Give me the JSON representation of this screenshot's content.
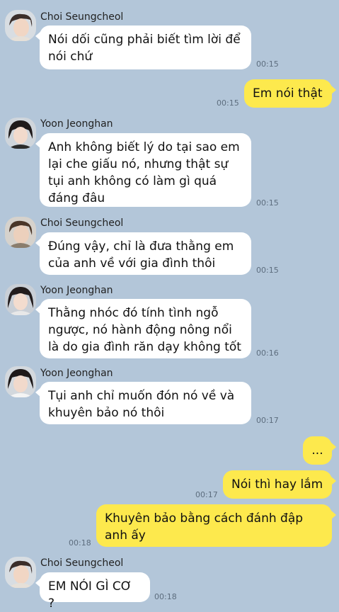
{
  "messages": [
    {
      "sender": "Choi Seungcheol",
      "text": "Nói dối cũng phải biết tìm lời để nói chứ",
      "time": "00:15"
    },
    {
      "text": "Em nói thật",
      "time": "00:15"
    },
    {
      "sender": "Yoon Jeonghan",
      "text": "Anh không biết lý do tại sao em lại che giấu nó, nhưng thật sự tụi anh không có làm gì quá đáng đâu",
      "time": "00:15"
    },
    {
      "sender": "Choi Seungcheol",
      "text": "Đúng vậy, chỉ là đưa thằng em của anh về với gia đình thôi",
      "time": "00:15"
    },
    {
      "sender": "Yoon Jeonghan",
      "text": "Thằng nhóc đó tính tình ngỗ ngược, nó hành động nông nổi là do gia đình răn dạy không tốt",
      "time": "00:16"
    },
    {
      "sender": "Yoon Jeonghan",
      "text": "Tụi anh chỉ muốn đón nó về và khuyên bảo nó thôi",
      "time": "00:17"
    },
    {
      "text": "...",
      "time": ""
    },
    {
      "text": "Nói thì hay lắm",
      "time": "00:17"
    },
    {
      "text": "Khuyên bảo bằng cách đánh đập anh ấy",
      "time": "00:18"
    },
    {
      "sender": "Choi Seungcheol",
      "text": "EM NÓI GÌ CƠ ?",
      "time": "00:18"
    }
  ],
  "colors": {
    "background": "#b3c6d9",
    "incoming": "#ffffff",
    "outgoing": "#fde94d"
  }
}
